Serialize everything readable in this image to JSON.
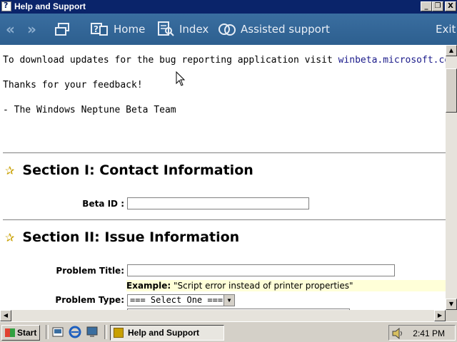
{
  "window": {
    "title": "Help and Support",
    "min": "_",
    "max": "❐",
    "close": "X"
  },
  "nav": {
    "back": "«",
    "forward": "»",
    "home": "Home",
    "index": "Index",
    "assisted": "Assisted support",
    "exit": "Exit"
  },
  "content": {
    "download_prefix": "To download updates for the bug reporting application visit ",
    "download_link": "winbeta.microsoft.com/bugrep",
    "download_suffix": ".",
    "thanks": "Thanks for your feedback!",
    "signature": " - The Windows Neptune Beta Team",
    "section1": "Section I: Contact Information",
    "beta_id_label": "Beta ID :",
    "section2": "Section II: Issue Information",
    "problem_title_label": "Problem Title:",
    "example_label": "Example:",
    "example_text": " \"Script error instead of printer properties\"",
    "problem_type_label": "Problem Type:",
    "problem_type_value": "=== Select One ==="
  },
  "taskbar": {
    "start": "Start",
    "task": "Help and Support",
    "clock": "2:41 PM"
  }
}
